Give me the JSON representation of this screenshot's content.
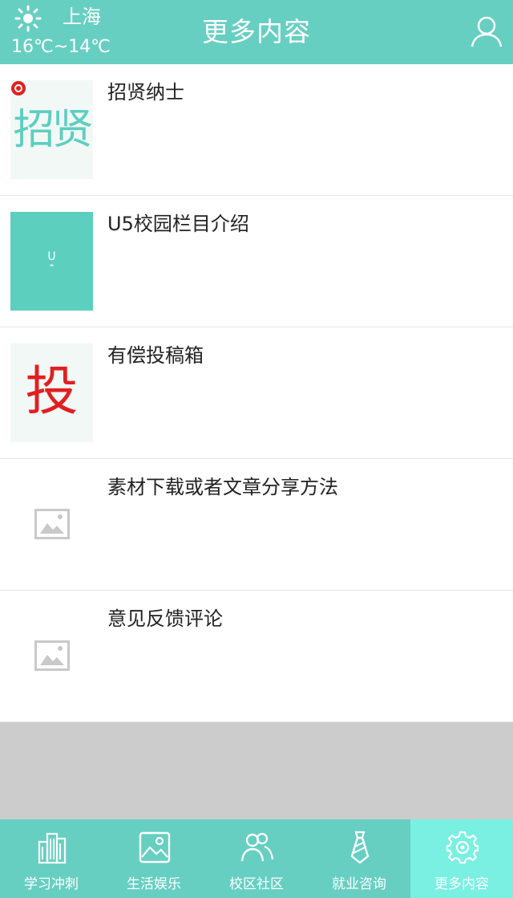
{
  "header": {
    "city": "上海",
    "temperature": "16℃~14℃",
    "title": "更多内容",
    "weather_icon": "sun-icon",
    "user_icon": "user-icon"
  },
  "list": [
    {
      "title": "招贤纳士",
      "thumb_text": "招贤"
    },
    {
      "title": "U5校园栏目介绍",
      "thumb_text": "U"
    },
    {
      "title": "有偿投稿箱",
      "thumb_text": "投"
    },
    {
      "title": "素材下载或者文章分享方法",
      "thumb_icon": "image-placeholder-icon"
    },
    {
      "title": "意见反馈评论",
      "thumb_icon": "image-placeholder-icon"
    }
  ],
  "tabs": [
    {
      "label": "学习冲刺",
      "icon": "building-icon",
      "active": false
    },
    {
      "label": "生活娱乐",
      "icon": "picture-icon",
      "active": false
    },
    {
      "label": "校区社区",
      "icon": "people-icon",
      "active": false
    },
    {
      "label": "就业咨询",
      "icon": "tie-icon",
      "active": false
    },
    {
      "label": "更多内容",
      "icon": "gear-icon",
      "active": true
    }
  ],
  "colors": {
    "header_bg": "#66cfc2",
    "tab_active_bg": "#79f0e2",
    "gray_area": "#cccccc",
    "accent_red": "#e02020"
  }
}
